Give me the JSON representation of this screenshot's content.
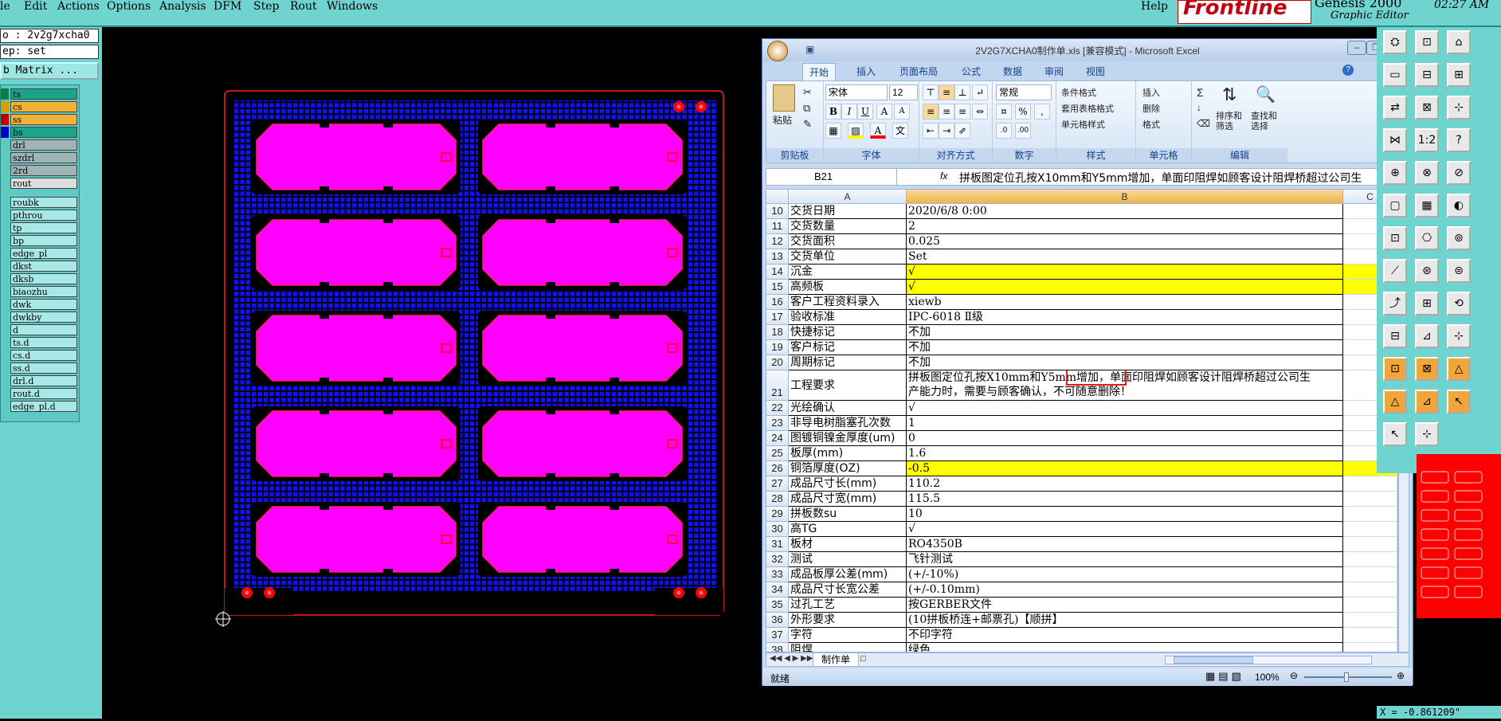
{
  "menubar": {
    "items": [
      "le",
      "Edit",
      "Actions",
      "Options",
      "Analysis",
      "DFM",
      "Step",
      "Rout",
      "Windows"
    ],
    "help": "Help",
    "logo": "Frontline",
    "product": "Genesis 2000",
    "subtitle": "Graphic Editor",
    "time": "02:27 AM"
  },
  "left_panel": {
    "job": "o : 2v2g7xcha0",
    "step": "ep: set",
    "matrix_button": "b Matrix ...",
    "layers": [
      {
        "name": "ts",
        "color": "#1aa58a",
        "style": "colored"
      },
      {
        "name": "cs",
        "color": "#f2b233",
        "style": "colored"
      },
      {
        "name": "ss",
        "color": "#f2b233",
        "style": "colored"
      },
      {
        "name": "bs",
        "color": "#1aa58a",
        "style": "colored"
      },
      {
        "name": "drl",
        "style": "grey"
      },
      {
        "name": "szdrl",
        "style": "grey"
      },
      {
        "name": "2rd",
        "style": "grey"
      },
      {
        "name": "rout",
        "style": "light"
      },
      {
        "name": "roubk",
        "style": "cyan"
      },
      {
        "name": "pthrou",
        "style": "cyan"
      },
      {
        "name": "tp",
        "style": "cyan"
      },
      {
        "name": "bp",
        "style": "cyan"
      },
      {
        "name": "edge_pl",
        "style": "cyan"
      },
      {
        "name": "dkst",
        "style": "cyan"
      },
      {
        "name": "dksb",
        "style": "cyan"
      },
      {
        "name": "biaozhu",
        "style": "cyan"
      },
      {
        "name": "dwk",
        "style": "cyan"
      },
      {
        "name": "dwkby",
        "style": "cyan"
      },
      {
        "name": "d",
        "style": "cyan"
      },
      {
        "name": "ts.d",
        "style": "cyan"
      },
      {
        "name": "cs.d",
        "style": "cyan"
      },
      {
        "name": "ss.d",
        "style": "cyan"
      },
      {
        "name": "drl.d",
        "style": "cyan"
      },
      {
        "name": "rout.d",
        "style": "cyan"
      },
      {
        "name": "edge_pl.d",
        "style": "cyan"
      }
    ]
  },
  "pcb": {
    "panel_count": 10,
    "board_fill": "#ff00ff",
    "grid_color": "#1111ff"
  },
  "excel": {
    "title": "2V2G7XCHA0制作单.xls  [兼容模式] - Microsoft Excel",
    "tabs": [
      "开始",
      "插入",
      "页面布局",
      "公式",
      "数据",
      "审阅",
      "视图"
    ],
    "ribbon": {
      "paste": "粘贴",
      "clipboard": "剪贴板",
      "font_name": "宋体",
      "font_size": "12",
      "font_group": "字体",
      "align_group": "对齐方式",
      "number_format": "常规",
      "number_group": "数字",
      "cond_format": "条件格式",
      "table_format": "套用表格格式",
      "cell_style": "单元格样式",
      "style_group": "样式",
      "insert": "插入",
      "delete": "删除",
      "format": "格式",
      "cells_group": "单元格",
      "sort_filter": "排序和筛选",
      "find_select": "查找和选择",
      "edit_group": "编辑"
    },
    "name_box": "B21",
    "formula": "拼板图定位孔按X10mm和Y5mm增加，单面印阻焊如顾客设计阻焊桥超过公司生",
    "columns": [
      "A",
      "B",
      "C"
    ],
    "rows": [
      {
        "n": "10",
        "a": "交货日期",
        "b": "2020/6/8 0:00"
      },
      {
        "n": "11",
        "a": "交货数量",
        "b": "2"
      },
      {
        "n": "12",
        "a": "交货面积",
        "b": "0.025"
      },
      {
        "n": "13",
        "a": "交货单位",
        "b": "Set"
      },
      {
        "n": "14",
        "a": "沉金",
        "b": "√",
        "yellow": true
      },
      {
        "n": "15",
        "a": "高频板",
        "b": "√",
        "yellow": true
      },
      {
        "n": "16",
        "a": "客户工程资料录入",
        "b": "xiewb"
      },
      {
        "n": "17",
        "a": "验收标准",
        "b": "IPC-6018 Ⅱ级"
      },
      {
        "n": "18",
        "a": "快捷标记",
        "b": "不加"
      },
      {
        "n": "19",
        "a": "客户标记",
        "b": "不加"
      },
      {
        "n": "20",
        "a": "周期标记",
        "b": "不加"
      },
      {
        "n": "21",
        "a": "工程要求",
        "b": "拼板图定位孔按X10mm和Y5mm增加，单面印阻焊如顾客设计阻焊桥超过公司生",
        "b2": "产能力时，需要与顾客确认，不可随意删除！",
        "tall": true
      },
      {
        "n": "22",
        "a": "光绘确认",
        "b": "√"
      },
      {
        "n": "23",
        "a": "非导电树脂塞孔次数",
        "b": "1"
      },
      {
        "n": "24",
        "a": "图镀铜镍金厚度(um)",
        "b": "0"
      },
      {
        "n": "25",
        "a": "板厚(mm)",
        "b": "1.6"
      },
      {
        "n": "26",
        "a": "铜箔厚度(OZ)",
        "b": "-0.5",
        "yellow": true
      },
      {
        "n": "27",
        "a": "成品尺寸长(mm)",
        "b": "110.2"
      },
      {
        "n": "28",
        "a": "成品尺寸宽(mm)",
        "b": "115.5"
      },
      {
        "n": "29",
        "a": "拼板数su",
        "b": "10"
      },
      {
        "n": "30",
        "a": "高TG",
        "b": "√"
      },
      {
        "n": "31",
        "a": "板材",
        "b": "RO4350B"
      },
      {
        "n": "32",
        "a": "测试",
        "b": "飞针测试"
      },
      {
        "n": "33",
        "a": "成品板厚公差(mm)",
        "b": "(+/-10%)"
      },
      {
        "n": "34",
        "a": "成品尺寸长宽公差",
        "b": "(+/-0.10mm)"
      },
      {
        "n": "35",
        "a": "过孔工艺",
        "b": "按GERBER文件"
      },
      {
        "n": "36",
        "a": "外形要求",
        "b": "(10拼板桥连+邮票孔)【顺拼】"
      },
      {
        "n": "37",
        "a": "字符",
        "b": "不印字符"
      },
      {
        "n": "38",
        "a": "阻焊",
        "b": "绿色"
      }
    ],
    "sheet_tab": "制作单",
    "status": "就绪",
    "zoom": "100%"
  },
  "coord_readout": "X = -0.861209\""
}
